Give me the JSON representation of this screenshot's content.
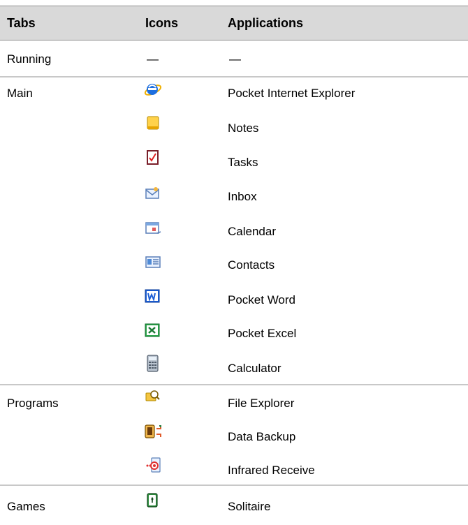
{
  "headers": {
    "tabs": "Tabs",
    "icons": "Icons",
    "applications": "Applications"
  },
  "rows": [
    {
      "tab": "Running",
      "icon": "none",
      "app": "—",
      "icon_dash": "—"
    },
    {
      "tab": "Main",
      "icon": "internet-explorer-icon",
      "app": "Pocket Internet Explorer"
    },
    {
      "tab": "",
      "icon": "notes-icon",
      "app": "Notes"
    },
    {
      "tab": "",
      "icon": "tasks-icon",
      "app": "Tasks"
    },
    {
      "tab": "",
      "icon": "inbox-icon",
      "app": "Inbox"
    },
    {
      "tab": "",
      "icon": "calendar-icon",
      "app": "Calendar"
    },
    {
      "tab": "",
      "icon": "contacts-icon",
      "app": "Contacts"
    },
    {
      "tab": "",
      "icon": "pocket-word-icon",
      "app": "Pocket Word"
    },
    {
      "tab": "",
      "icon": "pocket-excel-icon",
      "app": "Pocket Excel"
    },
    {
      "tab": "",
      "icon": "calculator-icon",
      "app": "Calculator"
    },
    {
      "tab": "Programs",
      "icon": "file-explorer-icon",
      "app": "File Explorer"
    },
    {
      "tab": "",
      "icon": "data-backup-icon",
      "app": "Data Backup"
    },
    {
      "tab": "",
      "icon": "infrared-receive-icon",
      "app": "Infrared Receive"
    },
    {
      "tab": "Games",
      "icon": "solitaire-icon",
      "app": "Solitaire"
    }
  ],
  "colors": {
    "header_bg": "#d9d9d9",
    "divider": "#c8c8c8"
  }
}
